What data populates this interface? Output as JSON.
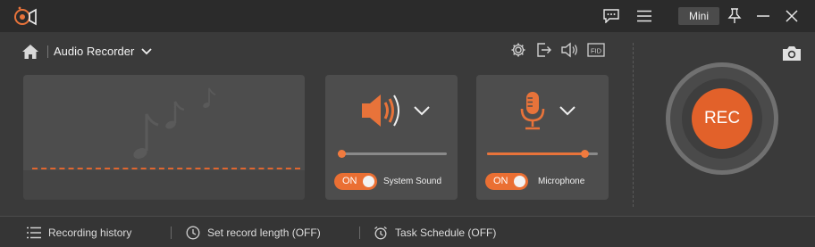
{
  "titlebar": {
    "logo_icon": "record-logo-icon",
    "chat_icon": "feedback-chat-icon",
    "menu_icon": "hamburger-menu-icon",
    "mini_label": "Mini",
    "pin_icon": "pin-icon",
    "minimize_icon": "minimize-icon",
    "close_icon": "close-icon"
  },
  "toolbar": {
    "home_icon": "home-icon",
    "mode_label": "Audio Recorder",
    "tools": [
      "settings-gear-icon",
      "export-icon",
      "volume-icon",
      "fid-icon"
    ],
    "fid_label": "FID"
  },
  "system_sound": {
    "toggle_label": "ON",
    "toggle_on": true,
    "label": "System Sound",
    "volume_fraction": 0.04
  },
  "microphone": {
    "toggle_label": "ON",
    "toggle_on": true,
    "label": "Microphone",
    "volume_fraction": 0.88
  },
  "rec_label": "REC",
  "bottombar": {
    "history": "Recording history",
    "length": "Set record length (OFF)",
    "schedule": "Task Schedule (OFF)"
  },
  "colors": {
    "accent": "#e8733a",
    "rec": "#e2612a",
    "background": "#3a3a3a",
    "panel": "#4d4d4d"
  }
}
